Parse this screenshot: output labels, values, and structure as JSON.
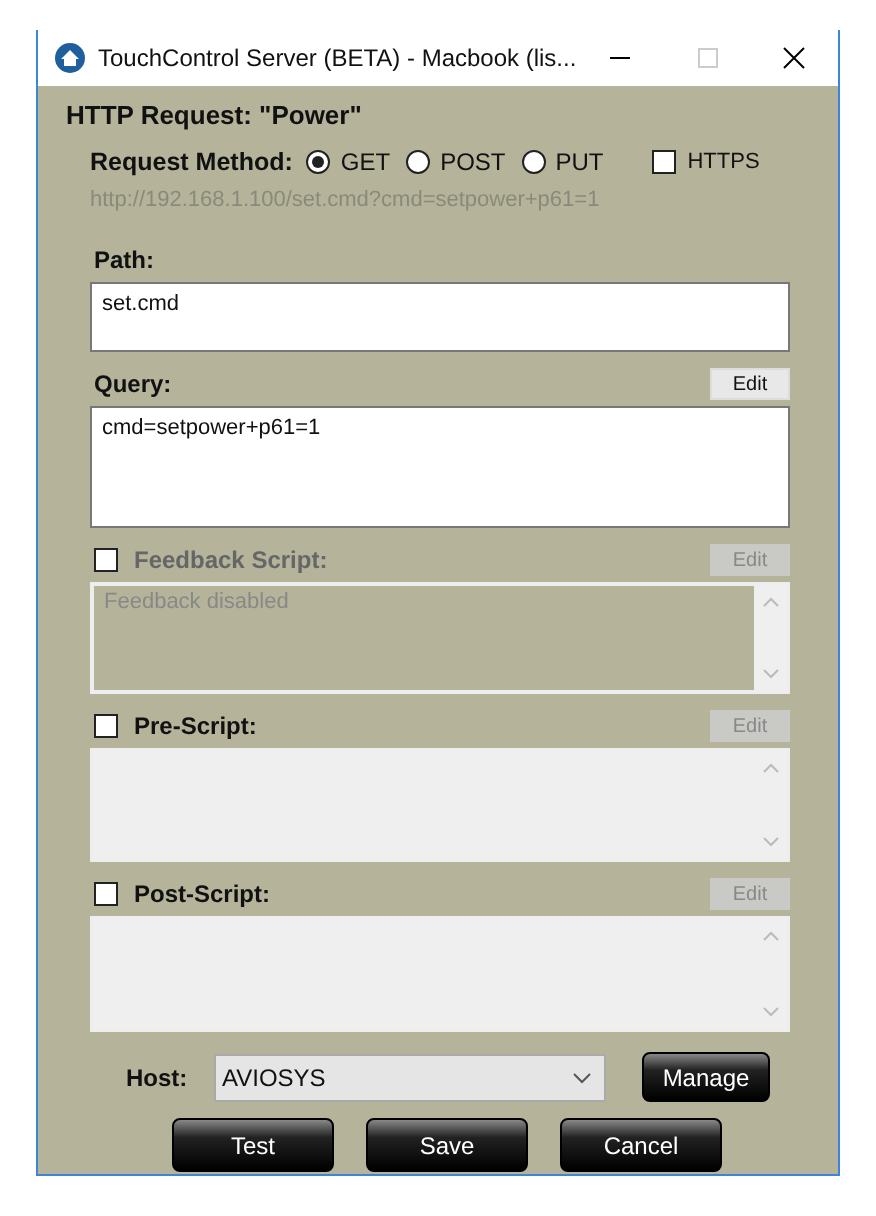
{
  "window": {
    "title": "TouchControl Server (BETA) - Macbook (lis..."
  },
  "heading": "HTTP Request: \"Power\"",
  "request_method": {
    "label": "Request Method:",
    "options": [
      {
        "label": "GET",
        "selected": true
      },
      {
        "label": "POST",
        "selected": false
      },
      {
        "label": "PUT",
        "selected": false
      }
    ]
  },
  "https": {
    "label": "HTTPS",
    "checked": false
  },
  "url_preview": "http://192.168.1.100/set.cmd?cmd=setpower+p61=1",
  "sections": [
    {
      "kind": "text",
      "label": "Path:",
      "value": "set.cmd"
    },
    {
      "kind": "text",
      "label": "Query:",
      "value": "cmd=setpower+p61=1",
      "edit_button": "Edit"
    },
    {
      "kind": "script",
      "label": "Feedback Script:",
      "checked": false,
      "disabled": true,
      "placeholder": "Feedback disabled",
      "edit_button": "Edit"
    },
    {
      "kind": "script",
      "label": "Pre-Script:",
      "checked": false,
      "disabled": false,
      "edit_button": "Edit"
    },
    {
      "kind": "script",
      "label": "Post-Script:",
      "checked": false,
      "disabled": false,
      "edit_button": "Edit"
    }
  ],
  "host": {
    "label": "Host:",
    "value": "AVIOSYS"
  },
  "manage_button": "Manage",
  "buttons": [
    "Test",
    "Save",
    "Cancel"
  ]
}
